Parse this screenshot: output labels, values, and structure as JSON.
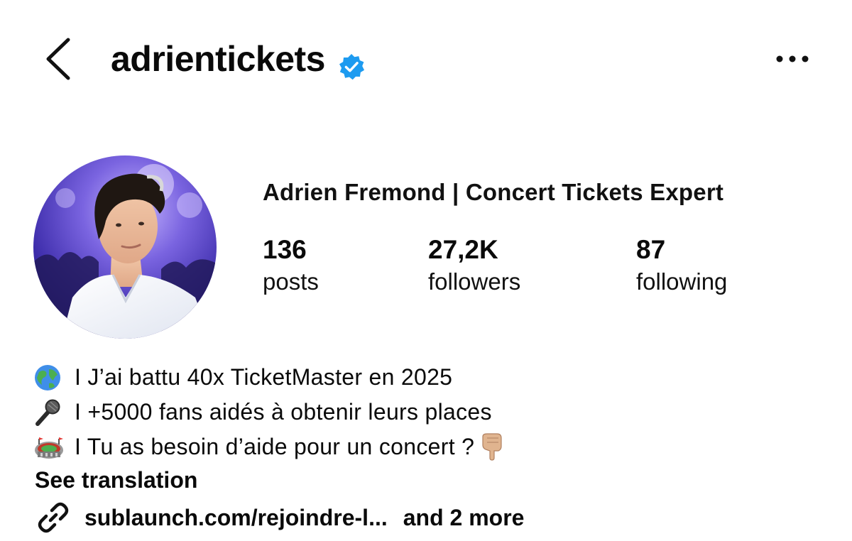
{
  "header": {
    "username": "adrientickets",
    "verified": true,
    "accent_color": "#1d9bf0"
  },
  "profile": {
    "full_name": "Adrien Fremond | Concert Tickets Expert",
    "avatar_icon": "profile-photo"
  },
  "stats": {
    "posts": {
      "value": "136",
      "label": "posts"
    },
    "followers": {
      "value": "27,2K",
      "label": "followers"
    },
    "following": {
      "value": "87",
      "label": "following"
    }
  },
  "bio": {
    "lines": [
      {
        "emoji": "globe-emoji",
        "text": "I J’ai battu 40x TicketMaster en 2025"
      },
      {
        "emoji": "microphone-emoji",
        "text": "I +5000 fans aidés à obtenir leurs places"
      },
      {
        "emoji": "stadium-emoji",
        "text": "I Tu as besoin d’aide pour un concert ?",
        "trailing_emoji": "pointing-down-emoji"
      }
    ],
    "see_translation": "See translation"
  },
  "links": {
    "icon": "link-icon",
    "url": "sublaunch.com/rejoindre-l...",
    "more": "and 2 more"
  }
}
